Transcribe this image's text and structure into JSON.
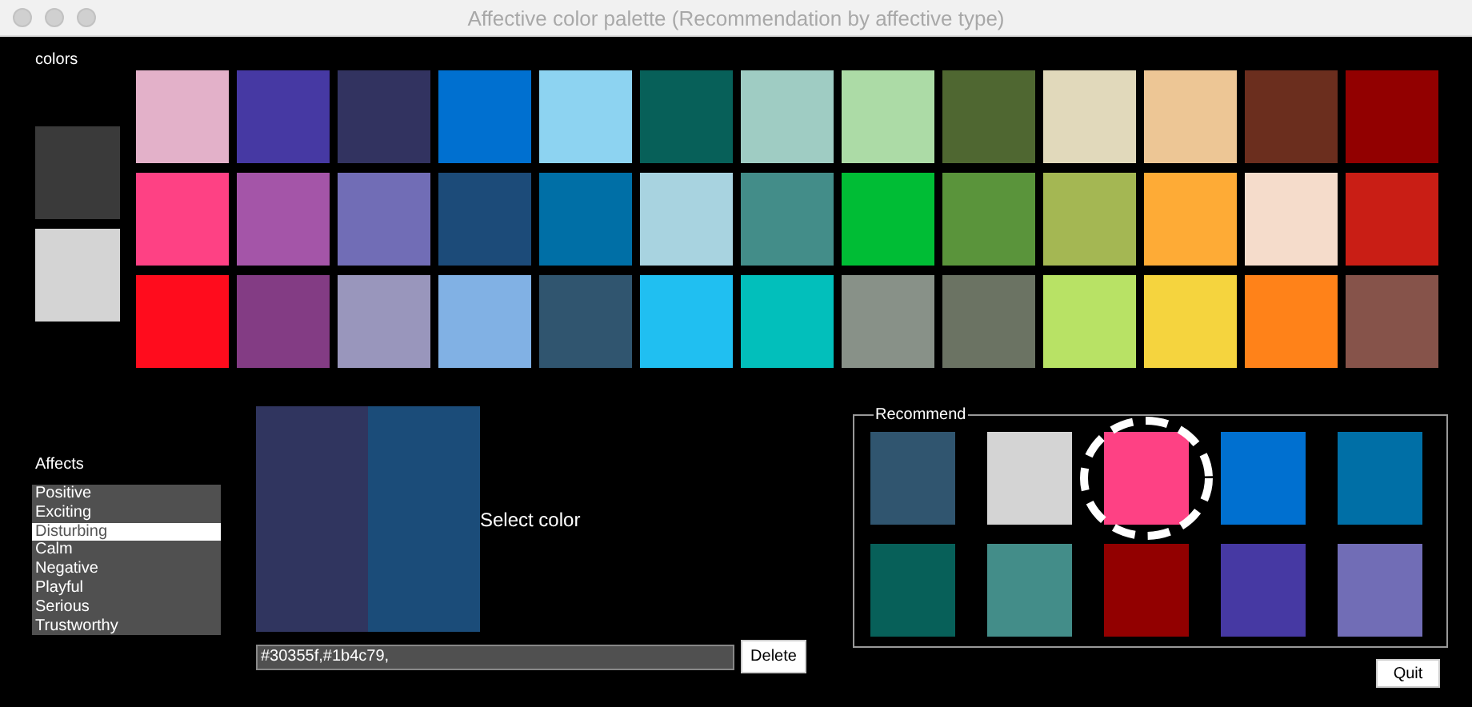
{
  "window": {
    "title": "Affective color palette (Recommendation by affective type)"
  },
  "colors_label": "colors",
  "side_swatches": [
    {
      "color": "#3a3a3a"
    },
    {
      "color": "#d4d4d4"
    }
  ],
  "palette": [
    {
      "colors": [
        {
          "color": "#e3b1c9"
        },
        {
          "color": "#4639a3"
        },
        {
          "color": "#323360"
        },
        {
          "color": "#0070d0"
        },
        {
          "color": "#8dd3f1"
        },
        {
          "color": "#076059"
        },
        {
          "color": "#9fccc3"
        },
        {
          "color": "#acdba6"
        },
        {
          "color": "#4f6731"
        },
        {
          "color": "#e1d9bb"
        },
        {
          "color": "#edc695"
        },
        {
          "color": "#6b2e1e"
        },
        {
          "color": "#920000"
        }
      ]
    },
    {
      "colors": [
        {
          "color": "#fe4184"
        },
        {
          "color": "#a455a8"
        },
        {
          "color": "#716db6"
        },
        {
          "color": "#1c4b79"
        },
        {
          "color": "#006fa6"
        },
        {
          "color": "#a8d3e0"
        },
        {
          "color": "#438d89"
        },
        {
          "color": "#00bd35"
        },
        {
          "color": "#5a943b"
        },
        {
          "color": "#a4b753"
        },
        {
          "color": "#feab36"
        },
        {
          "color": "#f5dccb"
        },
        {
          "color": "#c91e15"
        }
      ]
    },
    {
      "colors": [
        {
          "color": "#ff0c1d"
        },
        {
          "color": "#833c84"
        },
        {
          "color": "#9996bc"
        },
        {
          "color": "#81b1e4"
        },
        {
          "color": "#30556f"
        },
        {
          "color": "#20bff1"
        },
        {
          "color": "#02bfbb"
        },
        {
          "color": "#889188"
        },
        {
          "color": "#6b7363"
        },
        {
          "color": "#b8e265"
        },
        {
          "color": "#f5d43e"
        },
        {
          "color": "#ff8219"
        },
        {
          "color": "#86534a"
        }
      ]
    }
  ],
  "affects": {
    "label": "Affects",
    "items": [
      {
        "label": "Positive",
        "selected": false
      },
      {
        "label": "Exciting",
        "selected": false
      },
      {
        "label": "Disturbing",
        "selected": true
      },
      {
        "label": "Calm",
        "selected": false
      },
      {
        "label": "Negative",
        "selected": false
      },
      {
        "label": "Playful",
        "selected": false
      },
      {
        "label": "Serious",
        "selected": false
      },
      {
        "label": "Trustworthy",
        "selected": false
      }
    ]
  },
  "preview": {
    "colors": [
      {
        "color": "#30355f"
      },
      {
        "color": "#1b4c79"
      }
    ],
    "hint": "Select color"
  },
  "selection_field": {
    "value": "#30355f,#1b4c79,"
  },
  "delete_button": "Delete",
  "recommend": {
    "title": "Recommend",
    "swatches": [
      {
        "color": "#30556f",
        "selected": false
      },
      {
        "color": "#d4d4d4",
        "selected": false
      },
      {
        "color": "#fe4184",
        "selected": true
      },
      {
        "color": "#0070d0",
        "selected": false
      },
      {
        "color": "#006fa6",
        "selected": false
      },
      {
        "color": "#076059",
        "selected": false
      },
      {
        "color": "#438d89",
        "selected": false
      },
      {
        "color": "#920000",
        "selected": false
      },
      {
        "color": "#4639a3",
        "selected": false
      },
      {
        "color": "#716db6",
        "selected": false
      }
    ]
  },
  "quit_button": "Quit"
}
